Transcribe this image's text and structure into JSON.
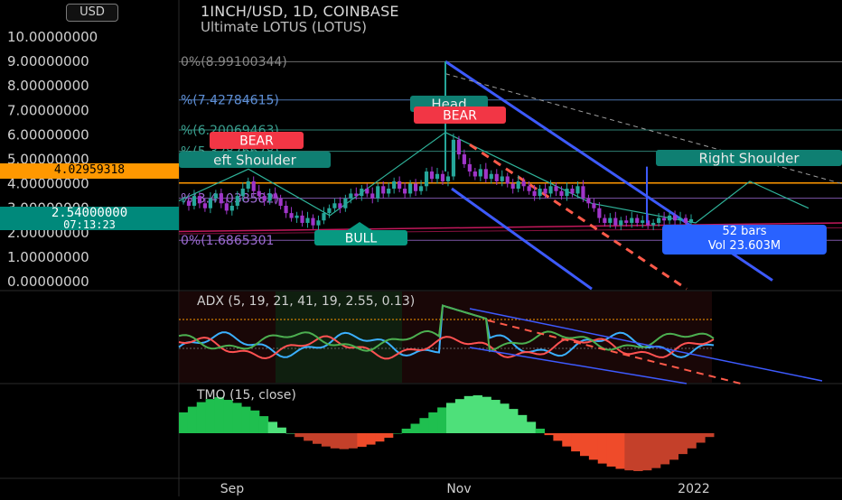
{
  "header": {
    "symbol_line": "1INCH/USD, 1D, COINBASE",
    "indicator_line": "Ultimate LOTUS (LOTUS)",
    "currency": "USD"
  },
  "price_scale": {
    "ticks": [
      "10.00000000",
      "9.00000000",
      "8.00000000",
      "7.00000000",
      "6.00000000",
      "5.00000000",
      "4.00000000",
      "3.00000000",
      "2.00000000",
      "1.00000000",
      "0.00000000"
    ],
    "orange_tag": "4.02959318",
    "current_tag": "2.54000000",
    "countdown": "07:13:23"
  },
  "fib_labels": [
    {
      "text": "0%(8.99100344)",
      "price": 9.0
    },
    {
      "text": "%(7.42784615)",
      "price": 7.43
    },
    {
      "text": "%(6.20069463)",
      "price": 6.2
    },
    {
      "text": "%(5.32876678)",
      "price": 5.33
    },
    {
      "text": "%(3.41038582)",
      "price": 3.41
    },
    {
      "text": "0%(1.6865301",
      "price": 1.69
    }
  ],
  "pattern_labels": {
    "left_shoulder": "eft Shoulder",
    "head": "Head",
    "right_shoulder": "Right Shoulder",
    "bear_1": "BEAR",
    "bear_2": "BEAR",
    "bull": "BULL"
  },
  "measure_box": {
    "bars": "52 bars",
    "vol": "Vol 23.603M"
  },
  "adx_panel": {
    "title": "ADX (5, 19, 21, 41, 19, 2.55, 0.13)"
  },
  "tmo_panel": {
    "title": "TMO (15, close)"
  },
  "time_axis": {
    "ticks": [
      "Sep",
      "Nov",
      "2022"
    ]
  },
  "colors": {
    "bg": "#000000",
    "up": "#26a69a",
    "down": "#a035c9",
    "bear": "#f23645",
    "bull": "#089981",
    "channel": "#3d5afe",
    "orange": "#ff9800",
    "teal": "#00897b",
    "tmo_green": "#22c55e",
    "tmo_red": "#ef4b2a",
    "adx_blue": "#3bb0ff",
    "adx_red": "#ff5252",
    "adx_green": "#4caf50"
  },
  "chart_data": {
    "type": "candlestick",
    "title": "1INCH/USD, 1D, COINBASE",
    "y_range": [
      0,
      10
    ],
    "x_ticks": [
      "Sep",
      "Nov",
      "2022"
    ],
    "highlighted_prices": [
      4.02959318,
      2.54
    ],
    "fib_levels": [
      8.99100344,
      7.42784615,
      6.20069463,
      5.32876678,
      3.41038582,
      1.6865301
    ],
    "close_path": [
      3.3,
      3.1,
      3.5,
      3.2,
      3.0,
      3.4,
      3.6,
      3.2,
      2.9,
      3.1,
      3.5,
      3.8,
      4.1,
      3.7,
      3.5,
      3.3,
      3.6,
      3.4,
      3.1,
      2.8,
      2.6,
      2.7,
      2.4,
      2.6,
      2.3,
      2.5,
      2.8,
      3.0,
      3.2,
      3.0,
      3.4,
      3.6,
      3.5,
      3.8,
      3.6,
      3.4,
      3.9,
      3.6,
      3.8,
      4.1,
      3.8,
      3.6,
      4.0,
      3.7,
      3.9,
      4.5,
      4.2,
      4.4,
      4.1,
      4.3,
      5.8,
      5.2,
      4.8,
      4.5,
      4.3,
      4.6,
      4.2,
      4.4,
      4.1,
      4.3,
      4.0,
      3.8,
      4.1,
      3.9,
      3.7,
      3.5,
      3.8,
      3.6,
      3.9,
      3.7,
      3.5,
      3.8,
      3.6,
      3.9,
      3.4,
      3.2,
      3.0,
      2.6,
      2.4,
      2.6,
      2.3,
      2.5,
      2.4,
      2.6,
      2.4,
      2.5,
      2.3,
      2.4,
      2.6,
      2.5,
      2.7,
      2.5,
      2.6,
      2.4,
      2.55
    ],
    "tmo_values": [
      0.55,
      0.7,
      0.82,
      0.9,
      0.95,
      0.88,
      0.8,
      0.7,
      0.6,
      0.45,
      0.3,
      0.15,
      0.0,
      -0.1,
      -0.2,
      -0.28,
      -0.35,
      -0.4,
      -0.42,
      -0.4,
      -0.36,
      -0.3,
      -0.22,
      -0.12,
      0.0,
      0.12,
      0.25,
      0.4,
      0.55,
      0.68,
      0.8,
      0.9,
      0.98,
      1.0,
      0.96,
      0.88,
      0.78,
      0.64,
      0.48,
      0.3,
      0.12,
      -0.05,
      -0.2,
      -0.35,
      -0.48,
      -0.6,
      -0.7,
      -0.8,
      -0.88,
      -0.94,
      -0.98,
      -1.0,
      -0.98,
      -0.92,
      -0.82,
      -0.7,
      -0.55,
      -0.4,
      -0.25,
      -0.1
    ]
  }
}
